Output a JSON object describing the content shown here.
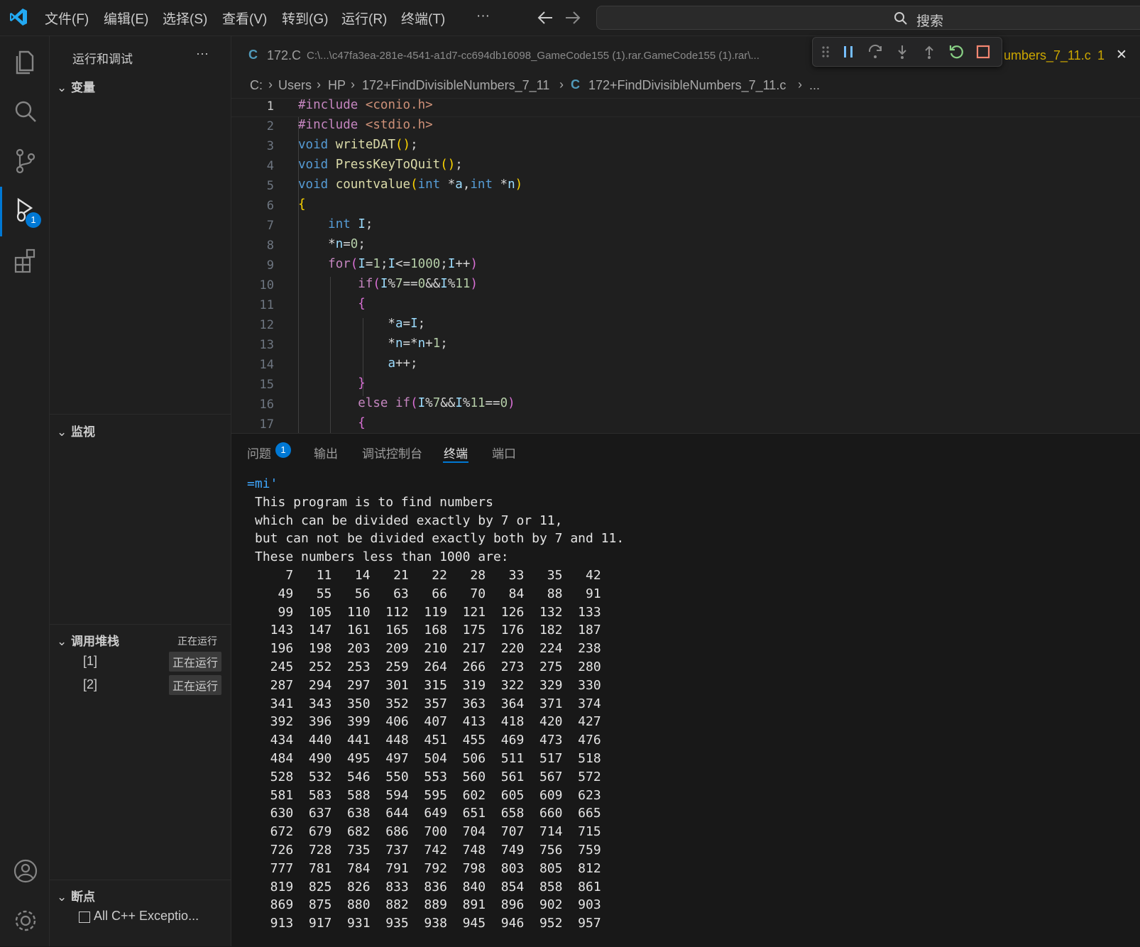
{
  "menu": [
    "文件(F)",
    "编辑(E)",
    "选择(S)",
    "查看(V)",
    "转到(G)",
    "运行(R)",
    "终端(T)",
    "···"
  ],
  "search": {
    "label": "搜索"
  },
  "activity": {
    "debug_badge": "1"
  },
  "sidebar": {
    "title": "运行和调试",
    "more": "···",
    "variables": "变量",
    "watch": "监视",
    "callstack": {
      "title": "调用堆栈",
      "status": "正在运行",
      "items": [
        {
          "label": "[1]",
          "status": "正在运行"
        },
        {
          "label": "[2]",
          "status": "正在运行"
        }
      ]
    },
    "breakpoints": {
      "title": "断点",
      "items": [
        {
          "label": "All C++ Exceptio..."
        }
      ]
    }
  },
  "tabs": {
    "left_icon": "C",
    "left_name": "172.C",
    "left_path": "C:\\...\\c47fa3ea-281e-4541-a1d7-cc694db16098_GameCode155 (1).rar.GameCode155 (1).rar\\...",
    "right_name": "umbers_7_11.c",
    "right_count": "1",
    "close": "✕"
  },
  "breadcrumb": [
    "C:",
    "Users",
    "HP",
    "172+FindDivisibleNumbers_7_11",
    "172+FindDivisibleNumbers_7_11.c",
    "..."
  ],
  "editor": {
    "line_numbers": [
      "1",
      "2",
      "3",
      "4",
      "5",
      "6",
      "7",
      "8",
      "9",
      "10",
      "11",
      "12",
      "13",
      "14",
      "15",
      "16",
      "17"
    ]
  },
  "panel": {
    "tabs": [
      "问题",
      "输出",
      "调试控制台",
      "终端",
      "端口"
    ],
    "problems_badge": "1",
    "active_tab": "终端",
    "prompt_line": "=mi'",
    "text_lines": [
      "This program is to find numbers",
      "which can be divided exactly by 7 or 11,",
      "but can not be divided exactly both by 7 and 11.",
      "These numbers less than 1000 are:"
    ],
    "number_rows": [
      [
        "7",
        "11",
        "14",
        "21",
        "22",
        "28",
        "33",
        "35",
        "42"
      ],
      [
        "49",
        "55",
        "56",
        "63",
        "66",
        "70",
        "84",
        "88",
        "91"
      ],
      [
        "99",
        "105",
        "110",
        "112",
        "119",
        "121",
        "126",
        "132",
        "133"
      ],
      [
        "143",
        "147",
        "161",
        "165",
        "168",
        "175",
        "176",
        "182",
        "187"
      ],
      [
        "196",
        "198",
        "203",
        "209",
        "210",
        "217",
        "220",
        "224",
        "238"
      ],
      [
        "245",
        "252",
        "253",
        "259",
        "264",
        "266",
        "273",
        "275",
        "280"
      ],
      [
        "287",
        "294",
        "297",
        "301",
        "315",
        "319",
        "322",
        "329",
        "330"
      ],
      [
        "341",
        "343",
        "350",
        "352",
        "357",
        "363",
        "364",
        "371",
        "374"
      ],
      [
        "392",
        "396",
        "399",
        "406",
        "407",
        "413",
        "418",
        "420",
        "427"
      ],
      [
        "434",
        "440",
        "441",
        "448",
        "451",
        "455",
        "469",
        "473",
        "476"
      ],
      [
        "484",
        "490",
        "495",
        "497",
        "504",
        "506",
        "511",
        "517",
        "518"
      ],
      [
        "528",
        "532",
        "546",
        "550",
        "553",
        "560",
        "561",
        "567",
        "572"
      ],
      [
        "581",
        "583",
        "588",
        "594",
        "595",
        "602",
        "605",
        "609",
        "623"
      ],
      [
        "630",
        "637",
        "638",
        "644",
        "649",
        "651",
        "658",
        "660",
        "665"
      ],
      [
        "672",
        "679",
        "682",
        "686",
        "700",
        "704",
        "707",
        "714",
        "715"
      ],
      [
        "726",
        "728",
        "735",
        "737",
        "742",
        "748",
        "749",
        "756",
        "759"
      ],
      [
        "777",
        "781",
        "784",
        "791",
        "792",
        "798",
        "803",
        "805",
        "812"
      ],
      [
        "819",
        "825",
        "826",
        "833",
        "836",
        "840",
        "854",
        "858",
        "861"
      ],
      [
        "869",
        "875",
        "880",
        "882",
        "889",
        "891",
        "896",
        "902",
        "903"
      ],
      [
        "913",
        "917",
        "931",
        "935",
        "938",
        "945",
        "946",
        "952",
        "957"
      ]
    ]
  },
  "colors": {
    "accent": "#0078d4",
    "background": "#181818",
    "panel_bar": "#1f1f1f",
    "modified_tab": "#cca700"
  }
}
